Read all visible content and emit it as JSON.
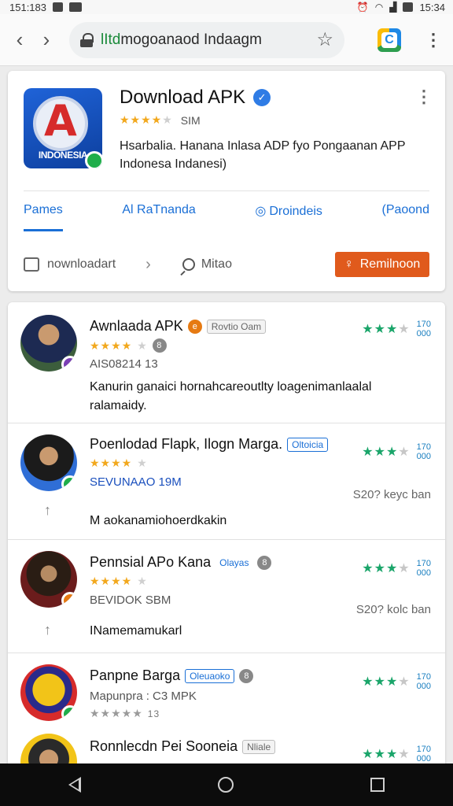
{
  "status_bar": {
    "time_left": "151:183",
    "time_right": "15:34"
  },
  "browser": {
    "url": "lItdmogoanaod Indaagm",
    "url_highlight": "lItd",
    "url_rest": "mogoanaod Indaagm"
  },
  "hero": {
    "logo_word": "INDONESIA",
    "title": "Download APK",
    "rating_stars": 4,
    "rating_text": "SIM",
    "description": "Hsarbalia. Hanana Inlasa ADP fyo Pongaanan APP Indonesa  Indanesi)",
    "tabs": [
      {
        "label": "Pames"
      },
      {
        "label": "Al  RaTnanda"
      },
      {
        "label": "Droindeis"
      },
      {
        "label": "(Paoond"
      }
    ],
    "actions": {
      "download_label": "nownloadart",
      "search_label": "Mitao",
      "remind_label": "Remilnoon"
    }
  },
  "list": [
    {
      "title": "Awnlaada APK",
      "tag": "Rovtio  Oam",
      "stars": 4,
      "sub": "AIS08214  13",
      "desc": "Kanurin ganaici hornahcareoutlty loagenimanlaalal ralamaidy.",
      "right_count": "170\n000"
    },
    {
      "title": "Poenlodad Flapk, Ilogn Marga.",
      "tag": "Oltoicia",
      "stars": 4,
      "sub": "SEVUNAAO 19M",
      "meta": "S20? keyc ban",
      "desc": "M aokanamiohoerdkakin",
      "right_count": "170\n000"
    },
    {
      "title": "Pennsial APo Kana",
      "tag": "Olayas",
      "stars": 4,
      "sub": "BEVIDOK  SBM",
      "meta": "S20? kolc ban",
      "desc": "INamemamukarl",
      "right_count": "170\n000"
    },
    {
      "title": "Panpne Barga",
      "tag": "Oleuaoko",
      "sub": "Mapunpra :  C3 MPK",
      "stars2": "13",
      "right_count": "170\n000"
    },
    {
      "title": "Ronnlecdn Pei Sooneia",
      "tag": "Nliale",
      "right_count": "170\n000"
    }
  ],
  "colors": {
    "accent_blue": "#1a6fd6",
    "remind_orange": "#e05a1c",
    "green_stars": "#1aa56a"
  }
}
